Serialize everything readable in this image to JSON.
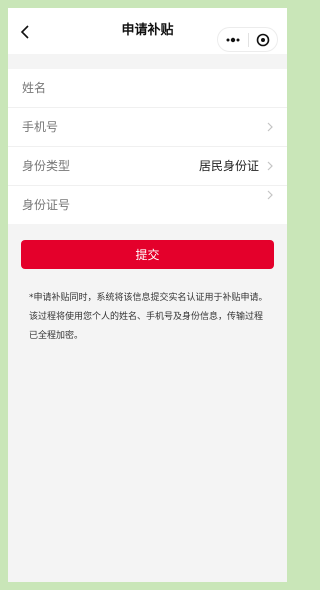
{
  "navbar": {
    "title": "申请补贴"
  },
  "form": {
    "fields": [
      {
        "label": "姓名",
        "value": ""
      },
      {
        "label": "手机号",
        "value": ""
      },
      {
        "label": "身份类型",
        "value": "居民身份证"
      },
      {
        "label": "身份证号",
        "value": ""
      }
    ]
  },
  "submit": {
    "label": "提交"
  },
  "notice": {
    "text": "*申请补贴同时，系统将该信息提交实名认证用于补贴申请。该过程将使用您个人的姓名、手机号及身份信息，传输过程已全程加密。"
  },
  "colors": {
    "accent": "#e4002b",
    "frame": "#c9e6b8",
    "background": "#f4f4f4"
  },
  "icons": [
    "back-arrow",
    "more-dots",
    "close-target",
    "chevron-right"
  ]
}
